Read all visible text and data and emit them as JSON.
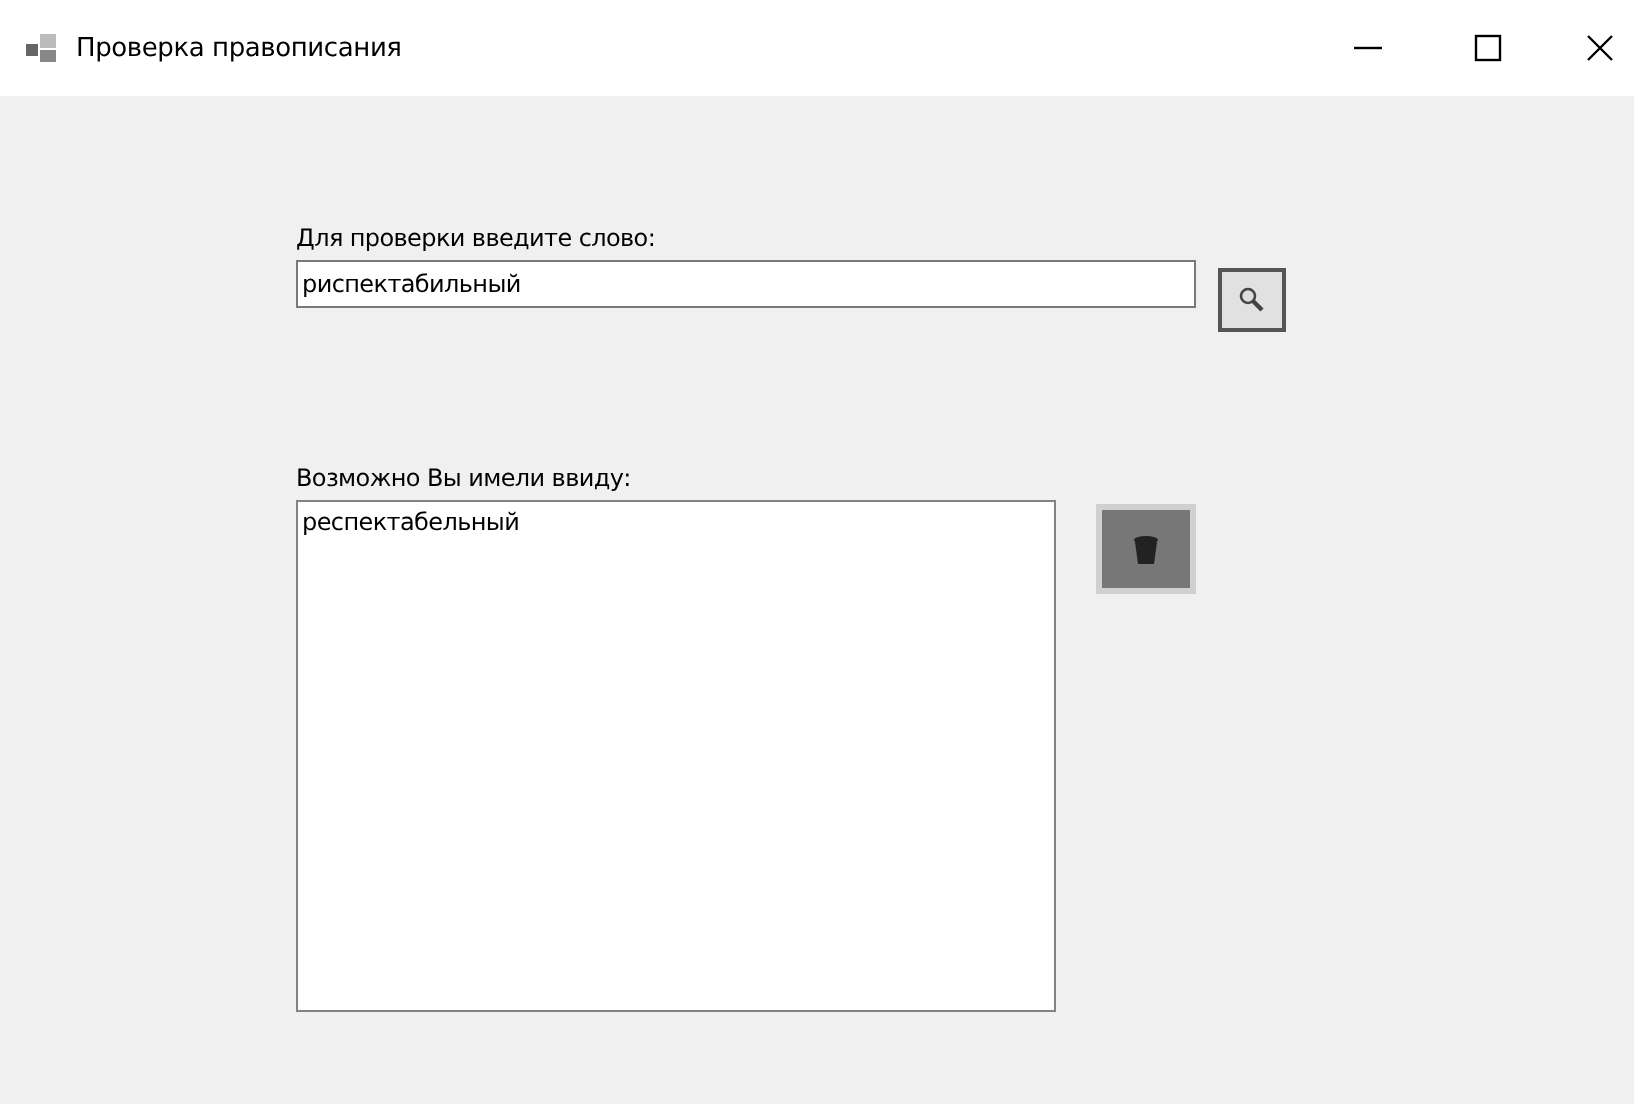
{
  "window": {
    "title": "Проверка правописания"
  },
  "word_input": {
    "label": "Для проверки введите слово:",
    "value": "риспектабильный"
  },
  "suggestions": {
    "label": "Возможно Вы имели ввиду:",
    "items": [
      {
        "text": "респектабельный",
        "selected": false
      }
    ]
  }
}
